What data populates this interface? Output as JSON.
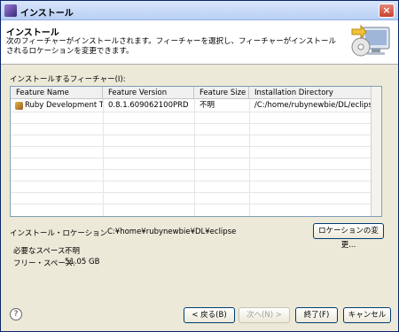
{
  "window": {
    "title": "インストール",
    "close_label": "×"
  },
  "header": {
    "title": "インストール",
    "description": "次のフィーチャーがインストールされます。フィーチャーを選択し、フィーチャーがインストールされるロケーションを変更できます。"
  },
  "features_label": "インストールするフィーチャー(I):",
  "table": {
    "columns": [
      "Feature Name",
      "Feature Version",
      "Feature Size",
      "Installation Directory"
    ],
    "rows": [
      [
        "Ruby Development T...",
        "0.8.1.609062100PRD",
        "不明",
        "/C:/home/rubynewbie/DL/eclipse/"
      ]
    ]
  },
  "location": {
    "label": "インストール・ロケーション",
    "value": "C:¥home¥rubynewbie¥DL¥eclipse",
    "change_button": "ロケーションの変更..."
  },
  "space": {
    "required_label": "必要なスペース:",
    "required_value": "不明",
    "free_label": "フリー・スペース:",
    "free_value": "51.05 GB"
  },
  "buttons": {
    "back": "< 戻る(B)",
    "next": "次へ(N) >",
    "finish": "終了(F)",
    "cancel": "キャンセル"
  },
  "help_glyph": "?"
}
